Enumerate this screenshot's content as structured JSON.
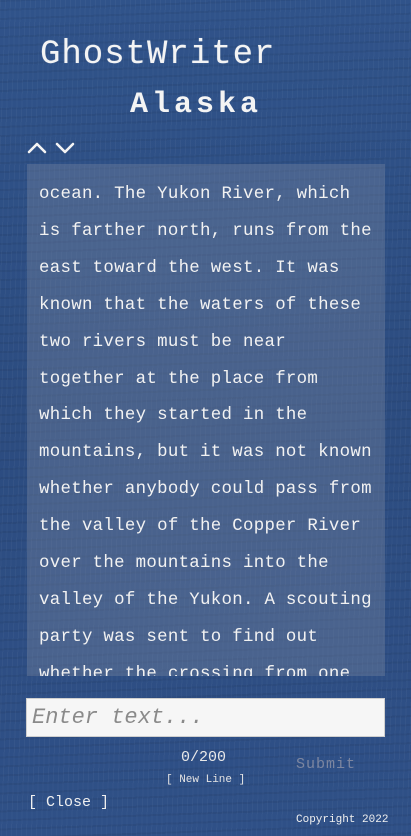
{
  "header": {
    "title_line1": "GhostWriter",
    "title_line2": "Alaska"
  },
  "scroll_controls": {
    "up_icon": "chevron-up-icon",
    "down_icon": "chevron-down-icon"
  },
  "reader": {
    "text": "ocean. The  Yukon River, which is farther north, runs from the east toward the west.  It was known that the waters of these two rivers must be near together at  the place from which they started in the mountains, but it was not known  whether anybody could pass from the valley of the Copper River over the  mountains into the valley of the Yukon. A scouting party was sent to find  out whether the crossing from one river to the"
  },
  "input": {
    "placeholder": "Enter text...",
    "value": ""
  },
  "counter": {
    "text": "0/200"
  },
  "buttons": {
    "new_line": "[ New Line ]",
    "submit": "Submit",
    "close": "[ Close ]"
  },
  "footer": {
    "copyright": "Copyright 2022"
  },
  "colors": {
    "background": "#2e4f85",
    "reader_panel": "#6f7f9c",
    "submit_disabled": "#7c86a0"
  }
}
